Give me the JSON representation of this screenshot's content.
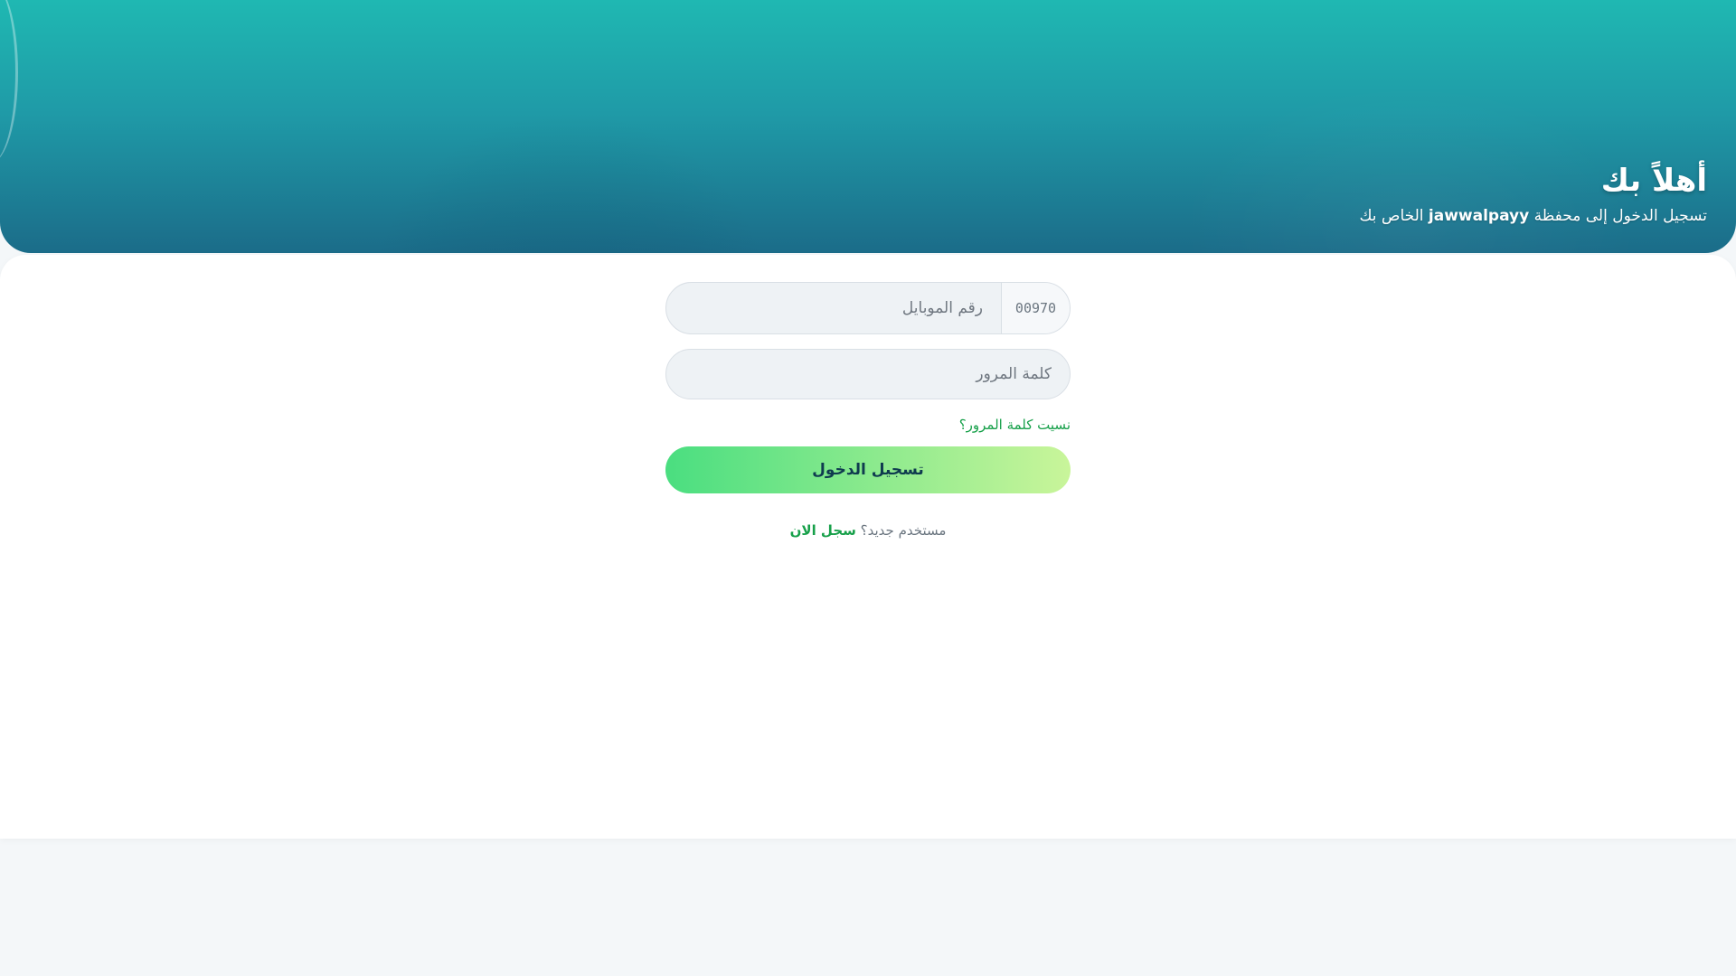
{
  "hero": {
    "title": "أهلاً بك",
    "subtitle_before": "تسجيل الدخول إلى محفظة",
    "brand": "jawwalpayy",
    "subtitle_after": "الخاص بك"
  },
  "form": {
    "phone_prefix": "00970",
    "phone_placeholder": "رقم الموبايل",
    "password_placeholder": "كلمة المرور",
    "forgot_label": "نسيت كلمة المرور؟",
    "login_label": "تسجيل الدخول",
    "new_user_label": "مستخدم جديد؟",
    "register_label": "سجل الان"
  },
  "colors": {
    "hero_top": "#1fb8b2",
    "hero_bottom": "#1b6c89",
    "accent_green": "#17a04a",
    "button_gradient_start": "#4ade80",
    "button_gradient_end": "#c9f59a",
    "button_text": "#0f3b4f"
  }
}
